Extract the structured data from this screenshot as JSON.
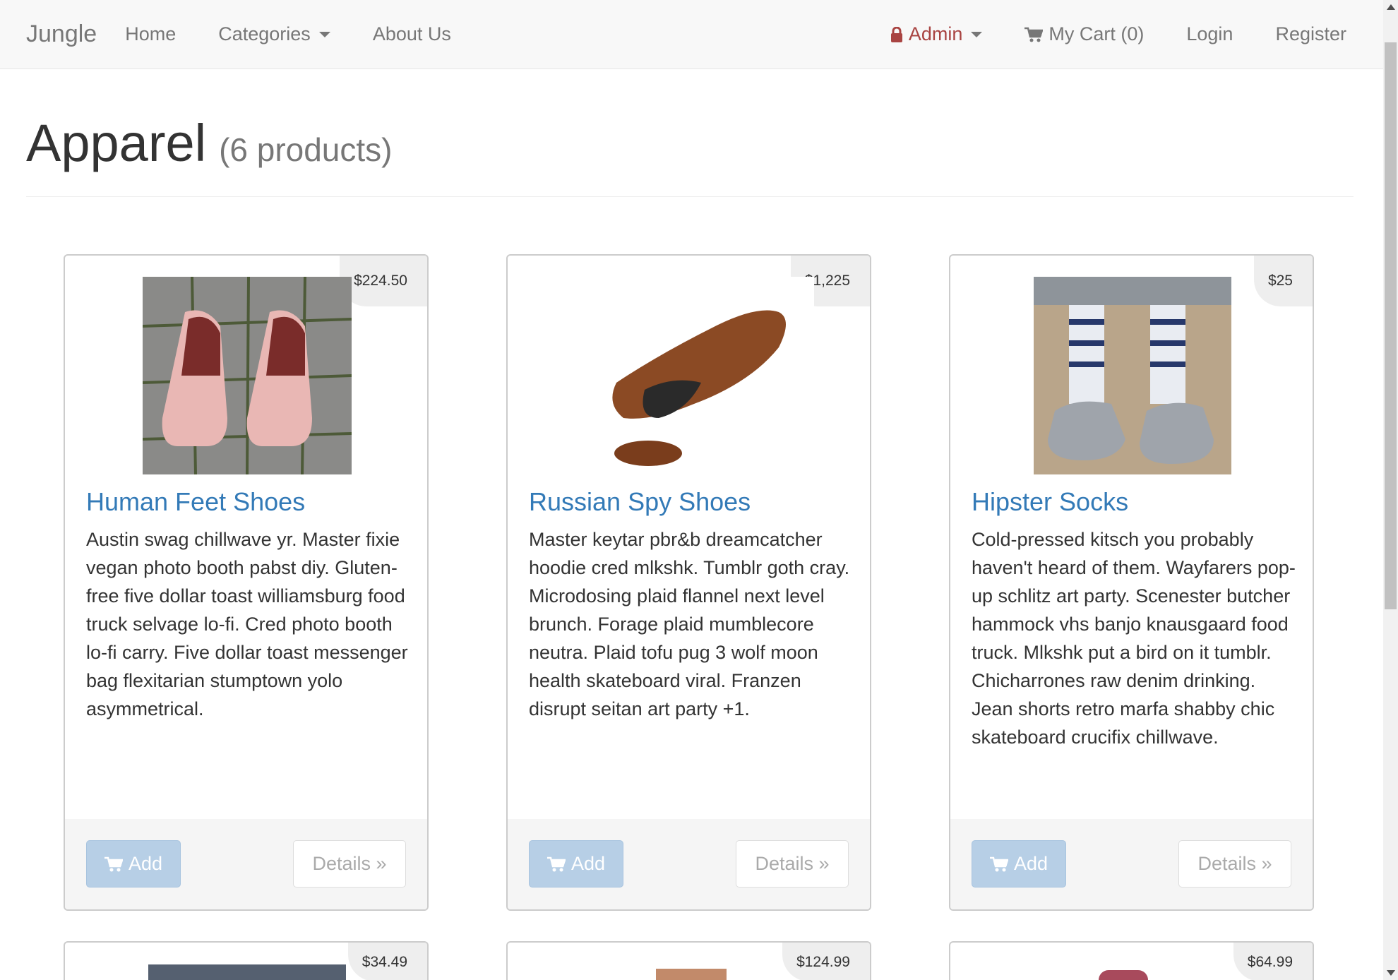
{
  "navbar": {
    "brand": "Jungle",
    "home": "Home",
    "categories": "Categories",
    "about": "About Us",
    "admin": "Admin",
    "cart": "My Cart (0)",
    "login": "Login",
    "register": "Register"
  },
  "page": {
    "title": "Apparel",
    "subtitle": "(6 products)"
  },
  "buttons": {
    "add": "Add",
    "details": "Details »"
  },
  "products": [
    {
      "name": "Human Feet Shoes",
      "price": "$224.50",
      "description": "Austin swag chillwave yr. Master fixie vegan photo booth pabst diy. Gluten-free five dollar toast williamsburg food truck selvage lo-fi. Cred photo booth lo-fi carry. Five dollar toast messenger bag flexitarian stumptown yolo asymmetrical."
    },
    {
      "name": "Russian Spy Shoes",
      "price": "$1,225",
      "description": "Master keytar pbr&b dreamcatcher hoodie cred mlkshk. Tumblr goth cray. Microdosing plaid flannel next level brunch. Forage plaid mumblecore neutra. Plaid tofu pug 3 wolf moon health skateboard viral. Franzen disrupt seitan art party +1."
    },
    {
      "name": "Hipster Socks",
      "price": "$25",
      "description": "Cold-pressed kitsch you probably haven't heard of them. Wayfarers pop-up schlitz art party. Scenester butcher hammock vhs banjo knausgaard food truck. Mlkshk put a bird on it tumblr. Chicharrones raw denim drinking. Jean shorts retro marfa shabby chic skateboard crucifix chillwave."
    },
    {
      "price": "$34.49"
    },
    {
      "price": "$124.99"
    },
    {
      "price": "$64.99"
    }
  ]
}
